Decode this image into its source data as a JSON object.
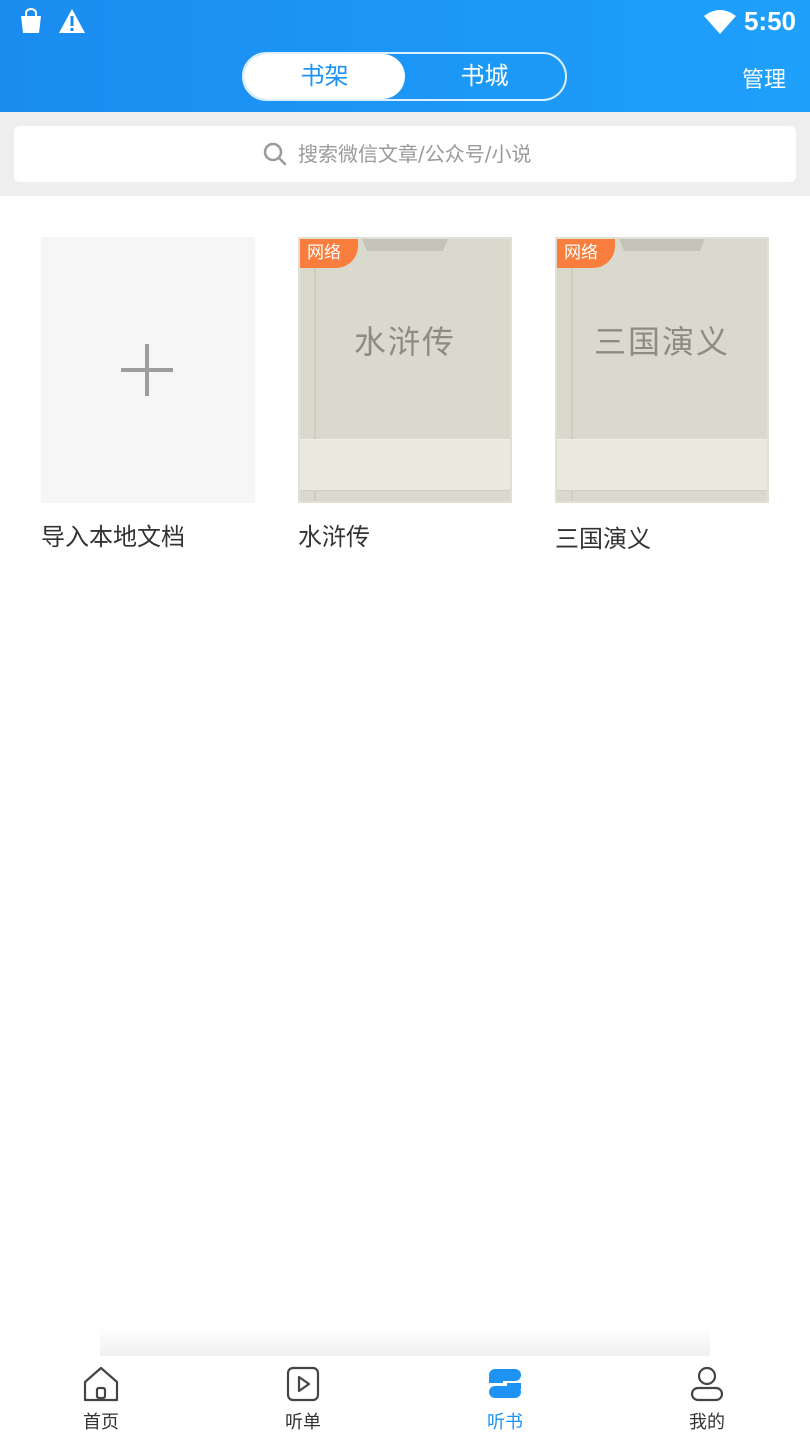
{
  "status_bar": {
    "time": "5:50"
  },
  "header": {
    "tabs": [
      {
        "label": "书架",
        "active": true
      },
      {
        "label": "书城",
        "active": false
      }
    ],
    "manage_label": "管理"
  },
  "search": {
    "placeholder": "搜索微信文章/公众号/小说"
  },
  "shelf": {
    "import_label": "导入本地文档",
    "books": [
      {
        "title": "水浒传",
        "cover_title": "水浒传",
        "tag": "网络"
      },
      {
        "title": "三国演义",
        "cover_title": "三国演义",
        "tag": "网络"
      }
    ]
  },
  "bottom_nav": {
    "items": [
      {
        "label": "首页",
        "icon": "home-icon",
        "active": false
      },
      {
        "label": "听单",
        "icon": "play-icon",
        "active": false
      },
      {
        "label": "听书",
        "icon": "book-icon",
        "active": true
      },
      {
        "label": "我的",
        "icon": "user-icon",
        "active": false
      }
    ]
  },
  "colors": {
    "accent": "#1e93f3",
    "tag": "#f97d3c"
  }
}
